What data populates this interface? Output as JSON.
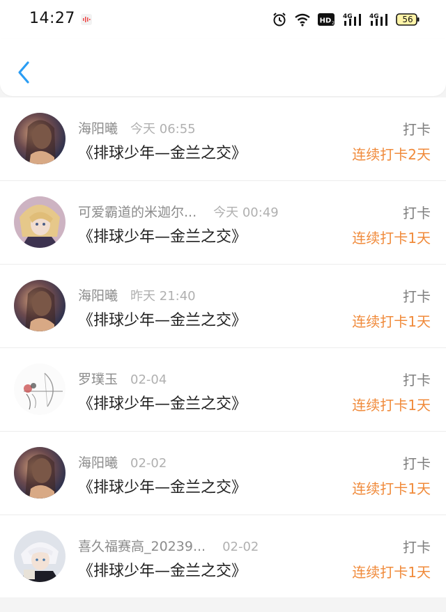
{
  "status_bar": {
    "time": "14:27",
    "battery_level": "56",
    "network_labels": [
      "HD",
      "4G",
      "4G"
    ],
    "icons": [
      "audio-wave-icon",
      "alarm-icon",
      "wifi-icon",
      "hd-icon",
      "signal-4g-icon",
      "signal-4g-icon",
      "battery-icon"
    ]
  },
  "header": {
    "back_icon": "chevron-left-icon",
    "accent_color": "#2a9df4"
  },
  "colors": {
    "streak": "#f08a3a",
    "name": "#8b8b8b",
    "title": "#222222"
  },
  "items": [
    {
      "name": "海阳曦",
      "time": "今天 06:55",
      "title": "《排球少年—金兰之交》",
      "action": "打卡",
      "streak": "连续打卡2天",
      "avatar": "portrait-dark"
    },
    {
      "name": "可爱霸道的米迦尔...",
      "time": "今天 00:49",
      "title": "《排球少年—金兰之交》",
      "action": "打卡",
      "streak": "连续打卡1天",
      "avatar": "anime-blonde"
    },
    {
      "name": "海阳曦",
      "time": "昨天 21:40",
      "title": "《排球少年—金兰之交》",
      "action": "打卡",
      "streak": "连续打卡1天",
      "avatar": "portrait-dark"
    },
    {
      "name": "罗璞玉",
      "time": "02-04",
      "title": "《排球少年—金兰之交》",
      "action": "打卡",
      "streak": "连续打卡1天",
      "avatar": "sketch-archer"
    },
    {
      "name": "海阳曦",
      "time": "02-02",
      "title": "《排球少年—金兰之交》",
      "action": "打卡",
      "streak": "连续打卡1天",
      "avatar": "portrait-dark"
    },
    {
      "name": "喜久福赛高_20239...",
      "time": "02-02",
      "title": "《排球少年—金兰之交》",
      "action": "打卡",
      "streak": "连续打卡1天",
      "avatar": "anime-white-hair"
    }
  ]
}
